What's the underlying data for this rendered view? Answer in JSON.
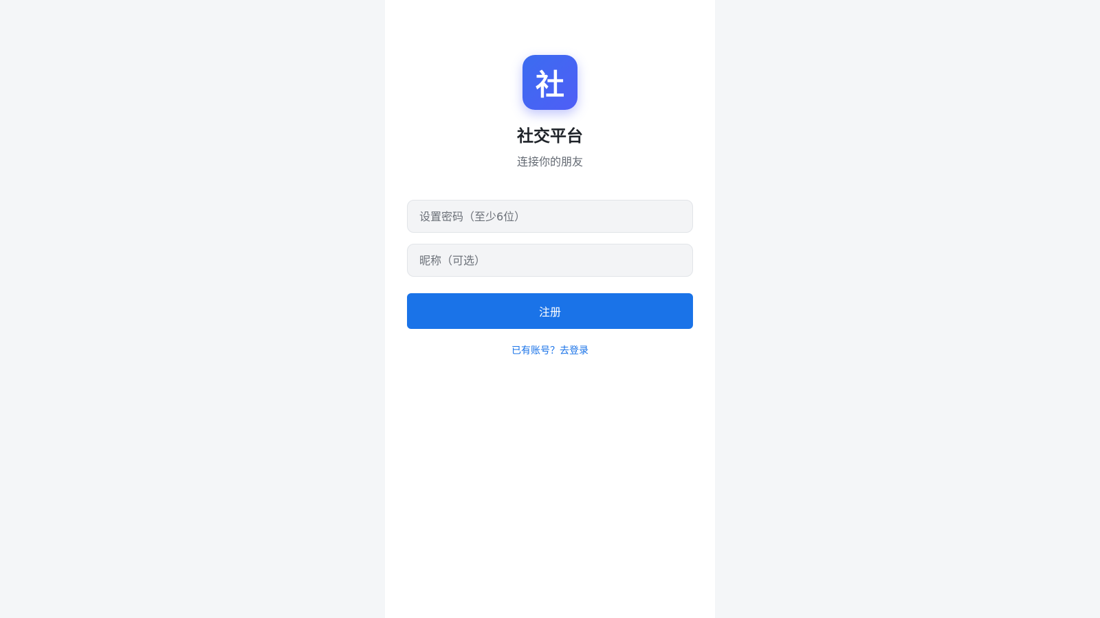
{
  "brand": {
    "logo_char": "社",
    "title": "社交平台",
    "subtitle": "连接你的朋友"
  },
  "form": {
    "password_placeholder": "设置密码（至少6位）",
    "password_value": "",
    "nickname_placeholder": "昵称（可选）",
    "nickname_value": "",
    "submit_label": "注册",
    "login_link": "已有账号？去登录"
  },
  "colors": {
    "page_background": "#f4f6f8",
    "panel_background": "#ffffff",
    "accent": "#1a73e8",
    "logo_gradient_start": "#3b6cf0",
    "logo_gradient_end": "#4f5ef6"
  }
}
